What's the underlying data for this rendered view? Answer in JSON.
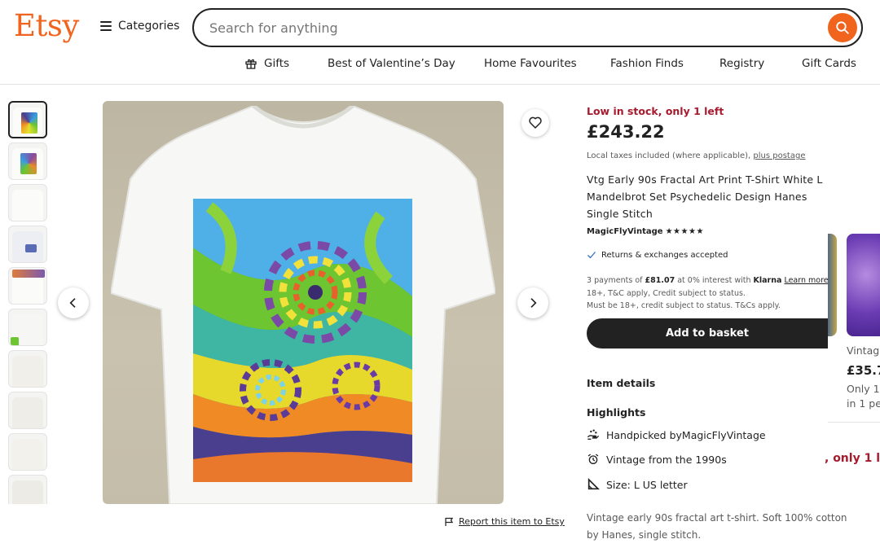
{
  "header": {
    "logo": "Etsy",
    "categories_label": "Categories",
    "search_placeholder": "Search for anything",
    "nav": [
      {
        "label": "Gifts"
      },
      {
        "label": "Best of Valentine’s Day"
      },
      {
        "label": "Home Favourites"
      },
      {
        "label": "Fashion Finds"
      },
      {
        "label": "Registry"
      },
      {
        "label": "Gift Cards"
      }
    ]
  },
  "gallery": {
    "thumbnail_count": 10,
    "report_label": "Report this item to Etsy"
  },
  "listing": {
    "stock": "Low in stock, only 1 left",
    "price": "£243.22",
    "tax_note": "Local taxes included (where applicable), ",
    "postage_link": "plus postage",
    "title": "Vtg Early 90s Fractal Art Print T-Shirt White L Mandelbrot Set Psychedelic Design Hanes Single Stitch",
    "shop_name": "MagicFlyVintage",
    "stars": "★★★★★",
    "returns": "Returns & exchanges accepted",
    "klarna_line1_a": "3 payments of ",
    "klarna_amount": "£81.07",
    "klarna_line1_b": " at 0% interest with ",
    "klarna_brand": "Klarna",
    "klarna_learn": "Learn more",
    "klarna_line2": "18+, T&C apply, Credit subject to status.",
    "klarna_line3": "Must be 18+, credit subject to status. T&Cs apply.",
    "basket_label": "Add to basket",
    "item_details": "Item details",
    "highlights_title": "Highlights",
    "highlights": {
      "handpicked_prefix": "Handpicked by ",
      "handpicked_shop": "MagicFlyVintage",
      "vintage": "Vintage from the 1990s",
      "size": "Size: L US letter"
    },
    "description": "Vintage early 90s fractal art t-shirt. Soft 100% cotton by Hanes, single stitch."
  },
  "overlay": {
    "caption": "Vintag",
    "price": "£35.7",
    "stock1": "Only 1",
    "stock2": "in 1 pe",
    "ribbon": ", only 1 l"
  },
  "colors": {
    "brand": "#f1641e",
    "stock_red": "#a61a2e",
    "dark": "#222222"
  }
}
